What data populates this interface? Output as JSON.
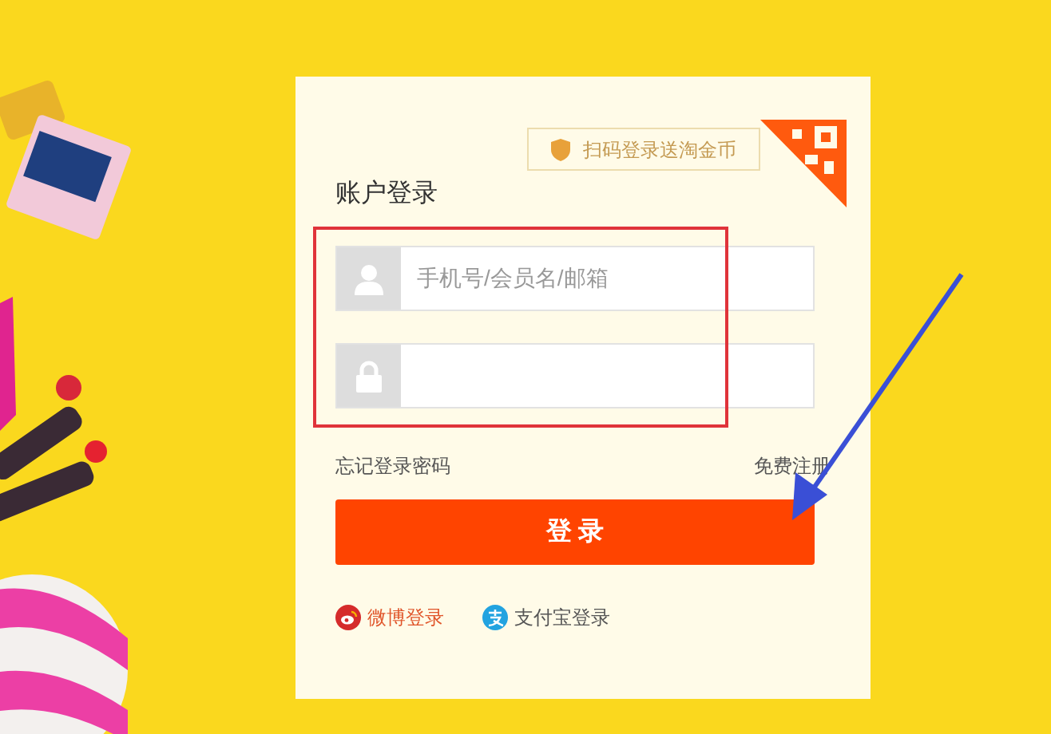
{
  "qr_promo": {
    "text": "扫码登录送淘金币"
  },
  "title": "账户登录",
  "fields": [
    {
      "kind": "user",
      "placeholder": "手机号/会员名/邮箱"
    },
    {
      "kind": "password"
    }
  ],
  "links": {
    "forgot": "忘记登录密码",
    "register": "免费注册"
  },
  "login_button": "登 录",
  "social_logins": [
    {
      "kind": "weibo",
      "label": "微博登录"
    },
    {
      "kind": "alipay",
      "label": "支付宝登录"
    }
  ]
}
